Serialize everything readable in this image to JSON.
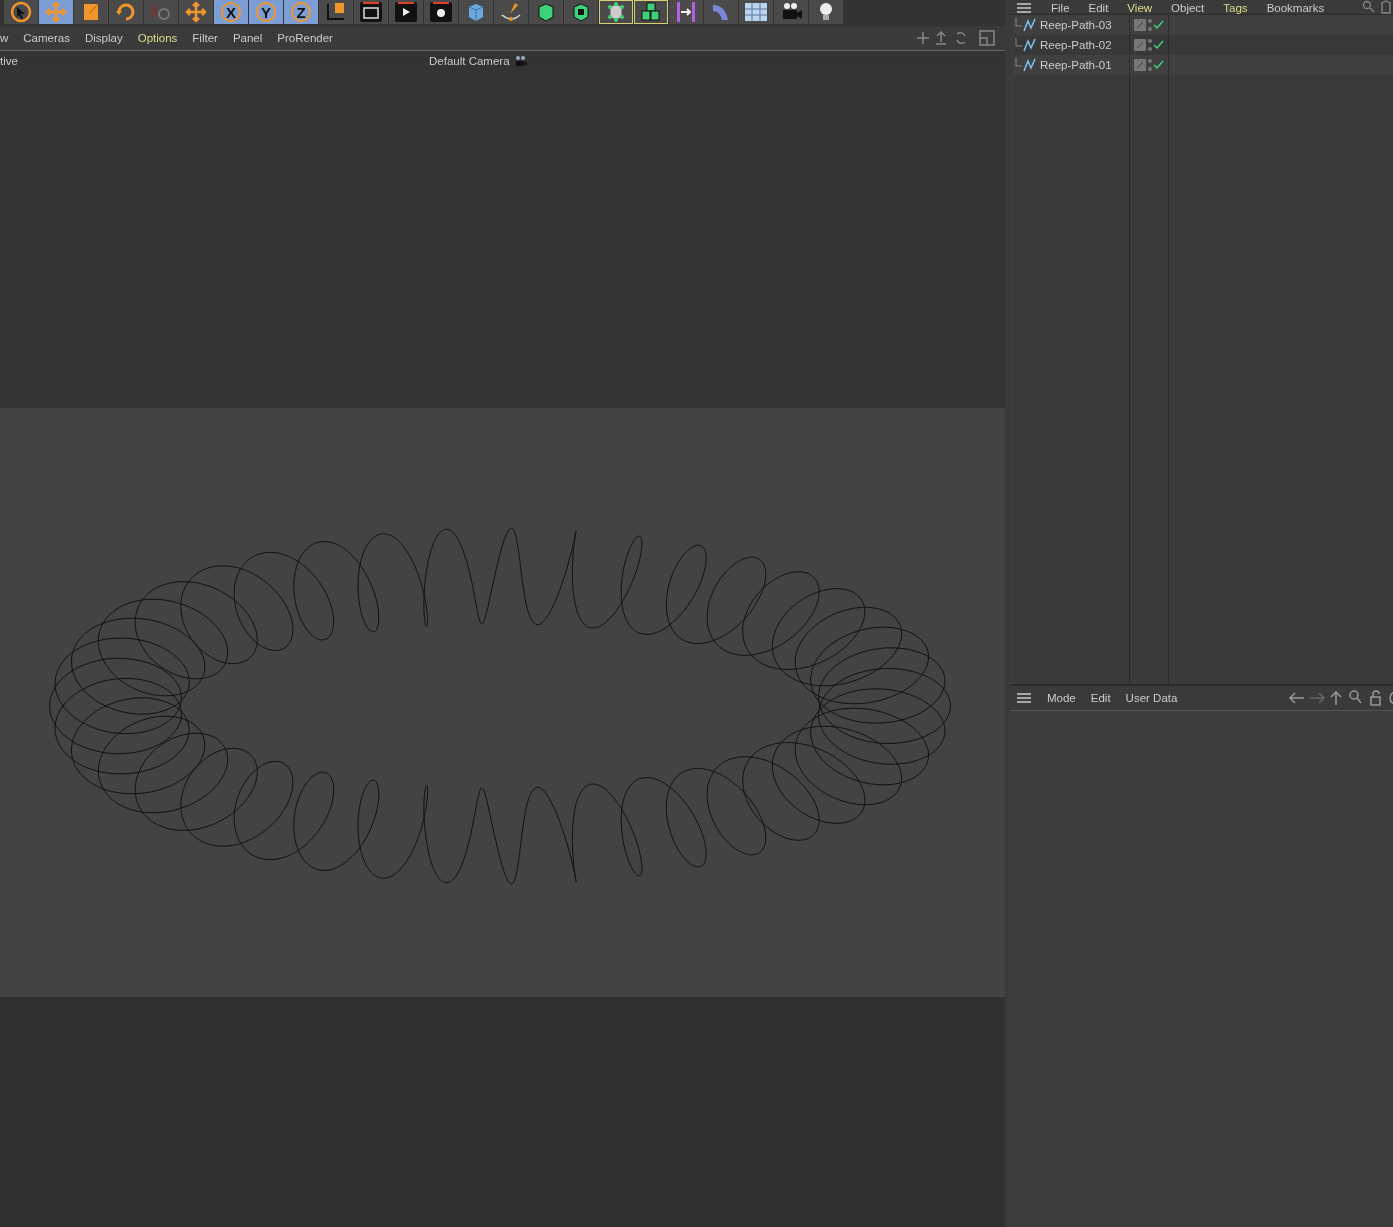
{
  "toolbar": [
    {
      "kind": "select",
      "selected": false
    },
    {
      "kind": "move",
      "selected": true
    },
    {
      "kind": "scale",
      "selected": false
    },
    {
      "kind": "rotate",
      "selected": false
    },
    {
      "kind": "coord-off",
      "selected": false
    },
    {
      "kind": "add",
      "selected": false
    },
    {
      "kind": "axis",
      "label": "X",
      "selected": true
    },
    {
      "kind": "axis",
      "label": "Y",
      "selected": true
    },
    {
      "kind": "axis",
      "label": "Z",
      "selected": true
    },
    {
      "kind": "world",
      "selected": false
    },
    {
      "kind": "render-view",
      "selected": false
    },
    {
      "kind": "render",
      "selected": false
    },
    {
      "kind": "render-settings",
      "selected": false
    },
    {
      "kind": "cube",
      "selected": false
    },
    {
      "kind": "pen",
      "selected": false
    },
    {
      "kind": "subdiv",
      "selected": false
    },
    {
      "kind": "extrude",
      "selected": false
    },
    {
      "kind": "array",
      "selected": false,
      "outlined": true
    },
    {
      "kind": "cloner",
      "selected": false,
      "outlined": true
    },
    {
      "kind": "deformer",
      "selected": false
    },
    {
      "kind": "bend",
      "selected": false
    },
    {
      "kind": "floor",
      "selected": false
    },
    {
      "kind": "camera",
      "selected": false
    },
    {
      "kind": "light",
      "selected": false
    }
  ],
  "viewport": {
    "menu": [
      {
        "label": "w",
        "selected": false
      },
      {
        "label": "Cameras",
        "selected": false
      },
      {
        "label": "Display",
        "selected": false
      },
      {
        "label": "Options",
        "selected": true
      },
      {
        "label": "Filter",
        "selected": false
      },
      {
        "label": "Panel",
        "selected": false
      },
      {
        "label": "ProRender",
        "selected": false
      }
    ],
    "view_name": "tive",
    "camera": "Default Camera"
  },
  "object_manager": {
    "menu": [
      {
        "label": "File",
        "selected": false
      },
      {
        "label": "Edit",
        "selected": false
      },
      {
        "label": "View",
        "selected": true
      },
      {
        "label": "Object",
        "selected": false
      },
      {
        "label": "Tags",
        "selected": true
      },
      {
        "label": "Bookmarks",
        "selected": false
      }
    ],
    "objects": [
      {
        "name": "Reep-Path-03",
        "enabled": true
      },
      {
        "name": "Reep-Path-02",
        "enabled": true
      },
      {
        "name": "Reep-Path-01",
        "enabled": true
      }
    ]
  },
  "attributes": {
    "menu": [
      "Mode",
      "Edit",
      "User Data"
    ]
  }
}
